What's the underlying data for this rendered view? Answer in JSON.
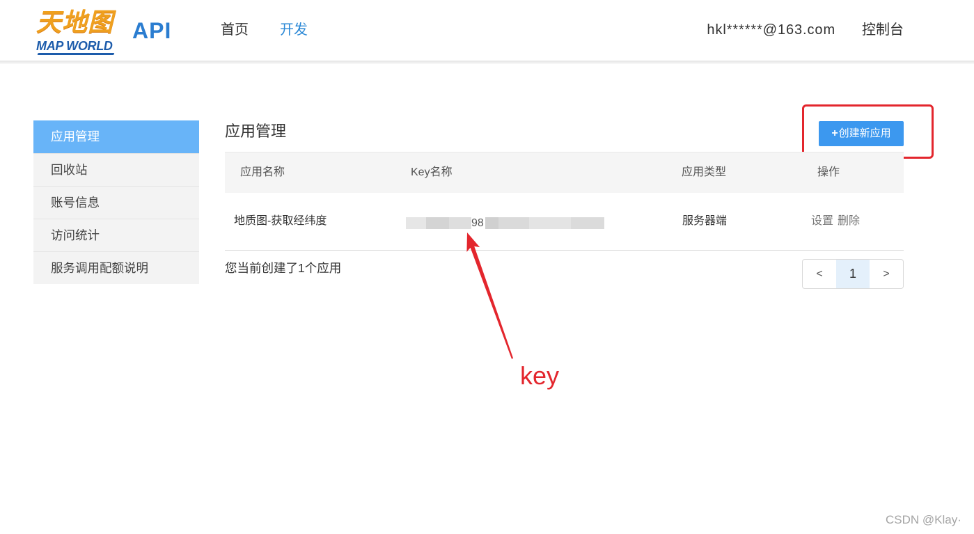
{
  "header": {
    "logo": {
      "title_cn": "天地图",
      "title_en": "MAP WORLD"
    },
    "product_label": "API",
    "nav": [
      {
        "label": "首页",
        "active": false
      },
      {
        "label": "开发",
        "active": true
      }
    ],
    "user_email": "hkl******@163.com",
    "console_label": "控制台"
  },
  "sidebar": {
    "items": [
      {
        "label": "应用管理",
        "active": true
      },
      {
        "label": "回收站",
        "active": false
      },
      {
        "label": "账号信息",
        "active": false
      },
      {
        "label": "访问统计",
        "active": false
      },
      {
        "label": "服务调用配额说明",
        "active": false
      }
    ]
  },
  "main": {
    "title": "应用管理",
    "create_button": {
      "icon": "plus-icon",
      "icon_glyph": "+",
      "label": "创建新应用"
    },
    "table": {
      "columns": [
        "应用名称",
        "Key名称",
        "应用类型",
        "操作"
      ],
      "rows": [
        {
          "app_name": "地质图-获取经纬度",
          "key_visible": "98",
          "app_type": "服务器端",
          "actions": [
            "设置",
            "删除"
          ]
        }
      ]
    },
    "summary": "您当前创建了1个应用",
    "pagination": {
      "prev": "<",
      "current_page": "1",
      "next": ">"
    }
  },
  "annotation": {
    "label": "key"
  },
  "watermark": "CSDN @Klay·",
  "colors": {
    "brand_blue": "#3c98ef",
    "sidebar_active": "#68b4f8",
    "nav_active": "#2b88d6",
    "annotation_red": "#e3262d",
    "logo_orange": "#efa01f",
    "logo_blue": "#1d5cab"
  }
}
